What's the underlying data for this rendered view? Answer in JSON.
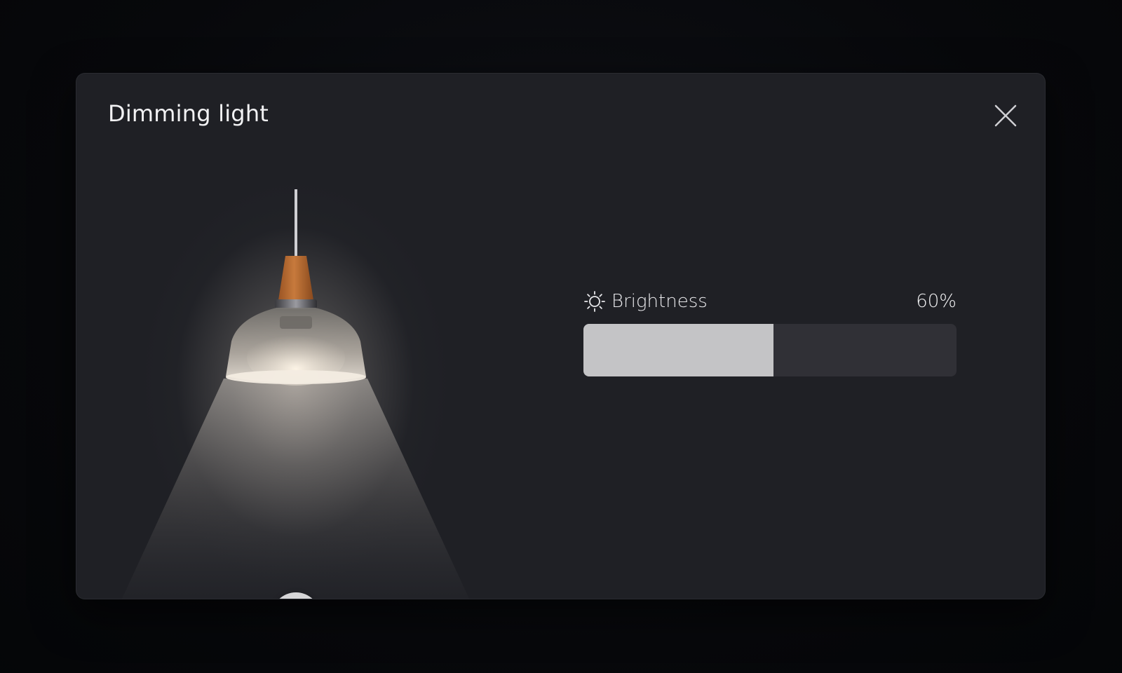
{
  "dialog": {
    "title": "Dimming light",
    "close_icon": "close-icon"
  },
  "lamp": {
    "image": "pendant-lamp",
    "power_icon": "power-icon",
    "state": "on"
  },
  "brightness": {
    "icon": "sun-icon",
    "label": "Brightness",
    "value_text": "60%",
    "value_fraction": 0.51
  },
  "colors": {
    "dialog_bg": "#1f2025",
    "slider_track": "#303036",
    "slider_fill": "#c4c4c6",
    "power_button": "#d6d6d8",
    "lamp_wood": "#b86a30"
  }
}
